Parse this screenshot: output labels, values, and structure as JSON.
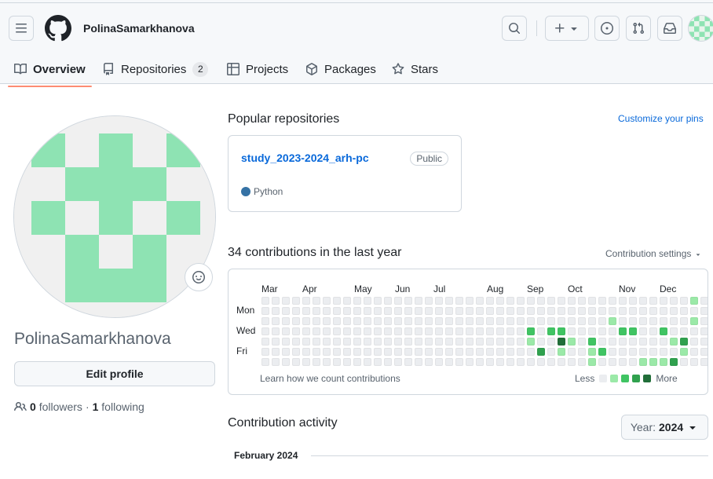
{
  "header": {
    "username": "PolinaSamarkhanova"
  },
  "tabs": [
    {
      "label": "Overview",
      "icon": "book-open-icon"
    },
    {
      "label": "Repositories",
      "icon": "repo-icon",
      "count": "2"
    },
    {
      "label": "Projects",
      "icon": "table-icon"
    },
    {
      "label": "Packages",
      "icon": "package-icon"
    },
    {
      "label": "Stars",
      "icon": "star-icon"
    }
  ],
  "profile": {
    "display_name": "PolinaSamarkhanova",
    "edit_label": "Edit profile",
    "followers_count": "0",
    "followers_label": "followers",
    "separator": "·",
    "following_count": "1",
    "following_label": "following"
  },
  "popular": {
    "title": "Popular repositories",
    "customize_label": "Customize your pins",
    "repos": [
      {
        "name": "study_2023-2024_arh-pc",
        "visibility": "Public",
        "language": "Python",
        "language_color": "#3572a5"
      }
    ]
  },
  "contributions": {
    "title": "34 contributions in the last year",
    "settings_label": "Contribution settings",
    "months": [
      "Mar",
      "Apr",
      "May",
      "Jun",
      "Jul",
      "Aug",
      "Sep",
      "Oct",
      "Nov",
      "Dec"
    ],
    "days": [
      "Mon",
      "Wed",
      "Fri"
    ],
    "learn_label": "Learn how we count contributions",
    "less_label": "Less",
    "more_label": "More",
    "level_colors": [
      "#ebedf0",
      "#9be9a8",
      "#40c463",
      "#30a14e",
      "#216e39"
    ]
  },
  "activity": {
    "title": "Contribution activity",
    "year_prefix": "Year:",
    "year_value": "2024",
    "first_month": "February 2024"
  }
}
